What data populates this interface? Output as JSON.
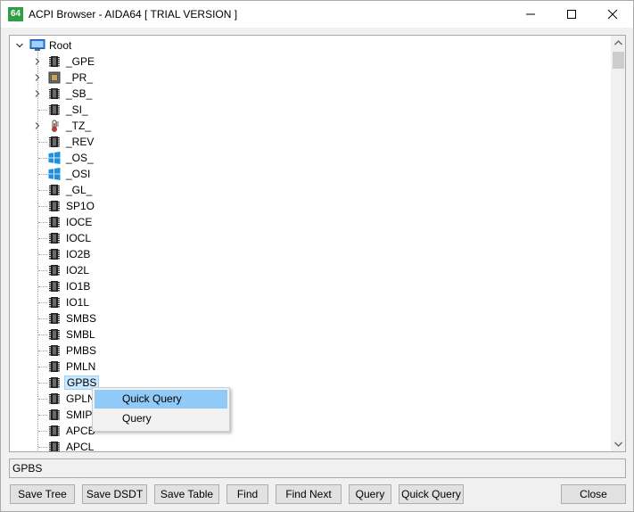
{
  "window": {
    "title": "ACPI Browser - AIDA64  [ TRIAL VERSION ]",
    "icon_text": "64"
  },
  "tree": {
    "root": "Root",
    "nodes": [
      {
        "label": "_GPE",
        "icon": "chip-icon",
        "expandable": true
      },
      {
        "label": "_PR_",
        "icon": "cpu-icon",
        "expandable": true
      },
      {
        "label": "_SB_",
        "icon": "chip-icon",
        "expandable": true
      },
      {
        "label": "_SI_",
        "icon": "chip-icon",
        "expandable": false
      },
      {
        "label": "_TZ_",
        "icon": "thermometer-icon",
        "expandable": true
      },
      {
        "label": "_REV",
        "icon": "chip-icon",
        "expandable": false
      },
      {
        "label": "_OS_",
        "icon": "windows-icon",
        "expandable": false
      },
      {
        "label": "_OSI",
        "icon": "windows-icon",
        "expandable": false
      },
      {
        "label": "_GL_",
        "icon": "chip-icon",
        "expandable": false
      },
      {
        "label": "SP1O",
        "icon": "chip-icon",
        "expandable": false
      },
      {
        "label": "IOCE",
        "icon": "chip-icon",
        "expandable": false
      },
      {
        "label": "IOCL",
        "icon": "chip-icon",
        "expandable": false
      },
      {
        "label": "IO2B",
        "icon": "chip-icon",
        "expandable": false
      },
      {
        "label": "IO2L",
        "icon": "chip-icon",
        "expandable": false
      },
      {
        "label": "IO1B",
        "icon": "chip-icon",
        "expandable": false
      },
      {
        "label": "IO1L",
        "icon": "chip-icon",
        "expandable": false
      },
      {
        "label": "SMBS",
        "icon": "chip-icon",
        "expandable": false
      },
      {
        "label": "SMBL",
        "icon": "chip-icon",
        "expandable": false
      },
      {
        "label": "PMBS",
        "icon": "chip-icon",
        "expandable": false
      },
      {
        "label": "PMLN",
        "icon": "chip-icon",
        "expandable": false
      },
      {
        "label": "GPBS",
        "icon": "chip-icon",
        "expandable": false,
        "selected": true
      },
      {
        "label": "GPLN",
        "icon": "chip-icon",
        "expandable": false
      },
      {
        "label": "SMIP",
        "icon": "chip-icon",
        "expandable": false
      },
      {
        "label": "APCB",
        "icon": "chip-icon",
        "expandable": false
      },
      {
        "label": "APCL",
        "icon": "chip-icon",
        "expandable": false
      }
    ]
  },
  "context_menu": {
    "items": [
      "Quick Query",
      "Query"
    ]
  },
  "status_value": "GPBS",
  "buttons": {
    "save_tree": "Save Tree",
    "save_dsdt": "Save DSDT",
    "save_table": "Save Table",
    "find": "Find",
    "find_next": "Find Next",
    "query": "Query",
    "quick_query": "Quick Query",
    "close": "Close"
  },
  "colors": {
    "selection": "#cce8ff",
    "menu_highlight": "#91c9f7",
    "app_icon": "#2f9e44"
  }
}
